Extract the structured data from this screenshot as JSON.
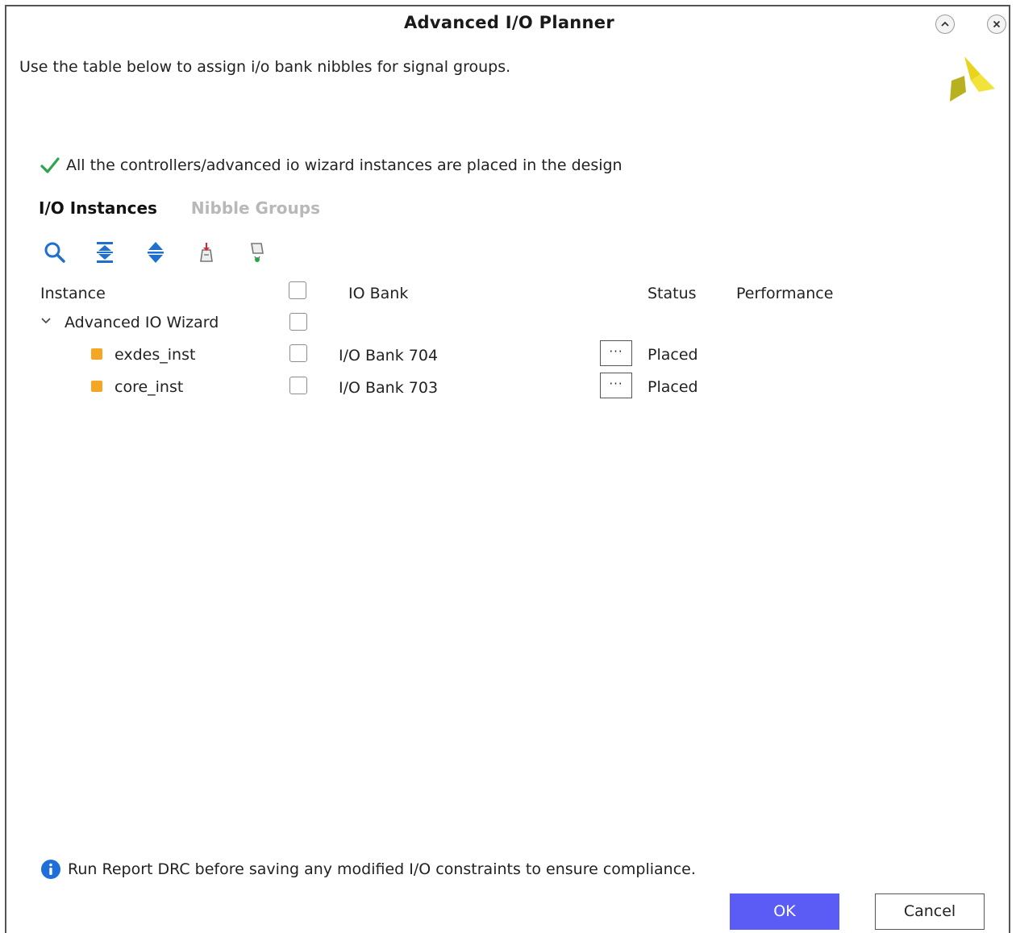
{
  "window": {
    "title": "Advanced I/O Planner"
  },
  "intro_text": "Use the table below to assign i/o bank nibbles for signal groups.",
  "status_message": "All the controllers/advanced io wizard instances are placed in the design",
  "tabs": [
    {
      "label": "I/O Instances",
      "active": true
    },
    {
      "label": "Nibble Groups",
      "active": false
    }
  ],
  "toolbar": [
    "search-icon",
    "collapse-all-icon",
    "expand-all-icon",
    "place-instance-icon",
    "unplace-instance-icon"
  ],
  "table": {
    "headers": {
      "instance": "Instance",
      "io_bank": "IO Bank",
      "status": "Status",
      "performance": "Performance"
    },
    "group": {
      "label": "Advanced IO Wizard",
      "checked": false
    },
    "rows": [
      {
        "instance": "exdes_inst",
        "io_bank": "I/O Bank 704",
        "status": "Placed",
        "button": "···"
      },
      {
        "instance": "core_inst",
        "io_bank": "I/O Bank 703",
        "status": "Placed",
        "button": "···"
      }
    ]
  },
  "info_message": "Run Report DRC before saving any modified I/O constraints to ensure compliance.",
  "buttons": {
    "ok": "OK",
    "cancel": "Cancel"
  },
  "colors": {
    "ok_button": "#5b5bf5",
    "instance_dot": "#f5a623",
    "check": "#2ea44f",
    "info": "#1e6fd9",
    "toolbar_icon": "#1f6fd0"
  }
}
